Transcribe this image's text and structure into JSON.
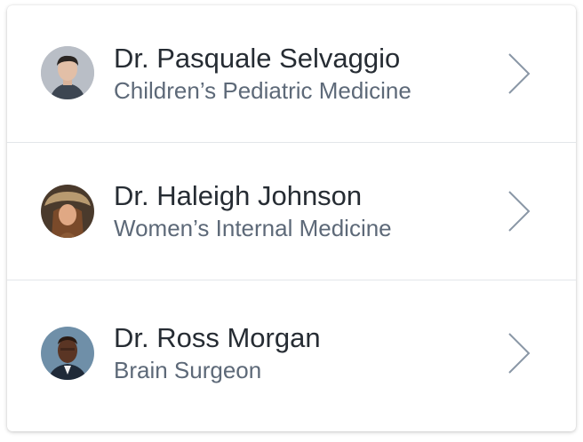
{
  "doctors": [
    {
      "name": "Dr. Pasquale Selvaggio",
      "specialty": "Children’s Pediatric Medicine",
      "avatar_icon": "person-avatar"
    },
    {
      "name": "Dr. Haleigh Johnson",
      "specialty": "Women’s Internal Medicine",
      "avatar_icon": "person-avatar"
    },
    {
      "name": "Dr. Ross Morgan",
      "specialty": "Brain Surgeon",
      "avatar_icon": "person-avatar"
    }
  ],
  "colors": {
    "name_text": "#262c33",
    "specialty_text": "#5d6978",
    "chevron": "#8a97a6",
    "divider": "#e3e6ea"
  },
  "row_icon": "chevron-right-icon"
}
